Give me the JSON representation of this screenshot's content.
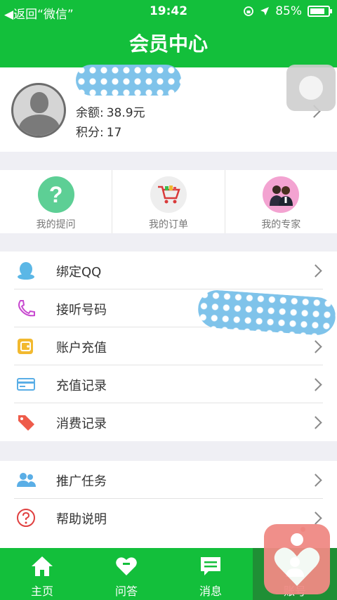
{
  "status_bar": {
    "back": "◀返回“微信”",
    "time": "19:42",
    "battery": "85%"
  },
  "header": {
    "title": "会员中心"
  },
  "profile": {
    "balance_label": "余额:",
    "balance_value": "38.9元",
    "points_label": "积分:",
    "points_value": "17"
  },
  "quick_actions": [
    {
      "label": "我的提问",
      "icon": "question-icon"
    },
    {
      "label": "我的订单",
      "icon": "cart-icon"
    },
    {
      "label": "我的专家",
      "icon": "experts-icon"
    }
  ],
  "menu_group_1": [
    {
      "label": "绑定QQ",
      "icon": "qq-icon"
    },
    {
      "label": "接听号码",
      "icon": "phone-icon"
    },
    {
      "label": "账户充值",
      "icon": "wallet-icon"
    },
    {
      "label": "充值记录",
      "icon": "card-icon"
    },
    {
      "label": "消费记录",
      "icon": "tag-icon"
    }
  ],
  "menu_group_2": [
    {
      "label": "推广任务",
      "icon": "users-icon"
    },
    {
      "label": "帮助说明",
      "icon": "help-icon"
    }
  ],
  "tabs": [
    {
      "label": "主页",
      "icon": "home-icon"
    },
    {
      "label": "问答",
      "icon": "qa-icon"
    },
    {
      "label": "消息",
      "icon": "message-icon"
    },
    {
      "label": "账号",
      "icon": "account-icon"
    }
  ],
  "colors": {
    "brand_green": "#13bf3b",
    "active_tab": "#1f8f35"
  }
}
